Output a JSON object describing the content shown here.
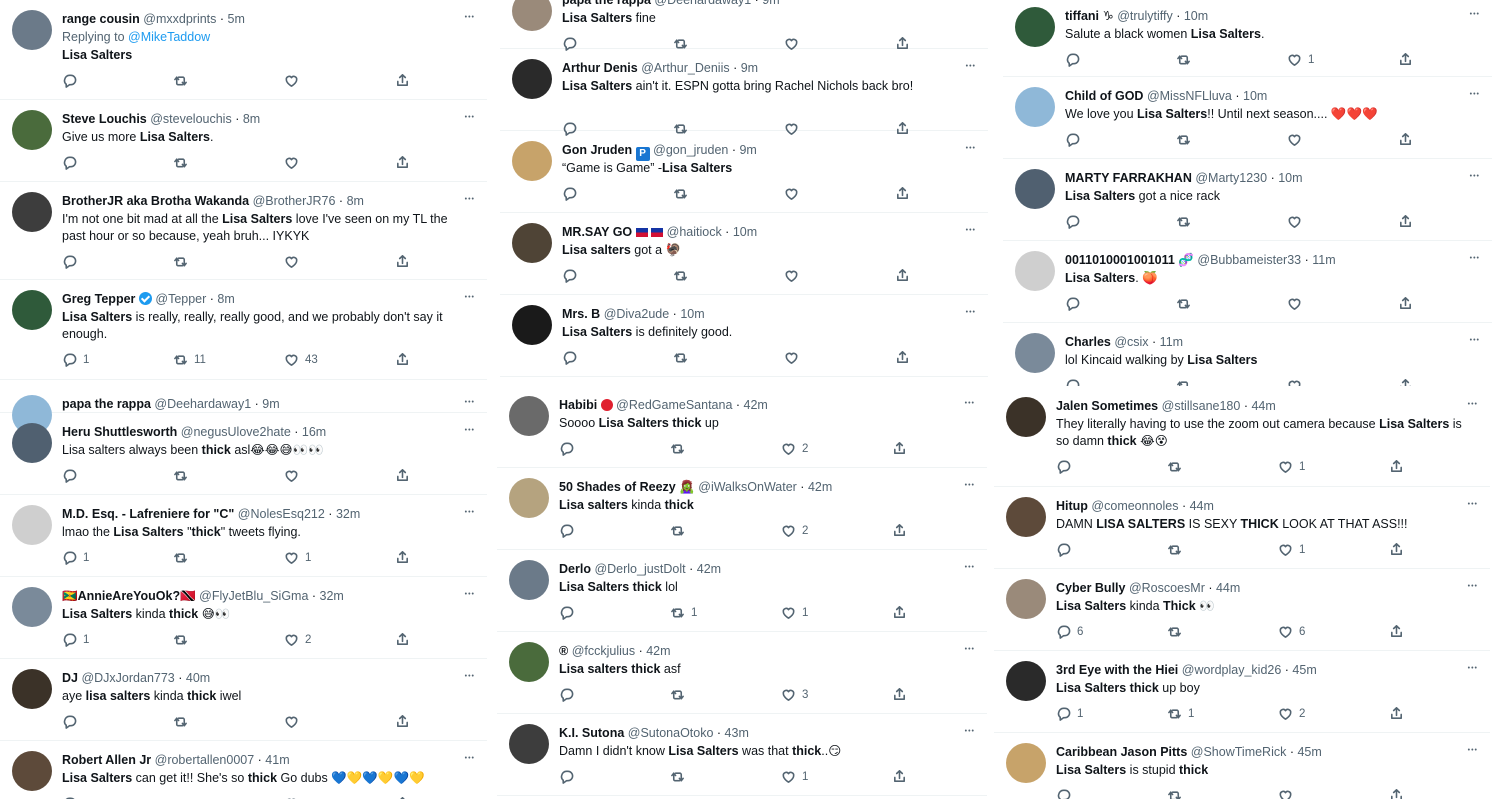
{
  "columns": [
    {
      "id": "col1",
      "tweets": [
        {
          "name": "range cousin",
          "handle": "@mxxdprints",
          "time": "5m",
          "reply_prefix": "Replying to ",
          "reply_to": "@MikeTaddow",
          "body": [
            {
              "b": "Lisa Salters"
            }
          ],
          "counts": [
            "",
            "",
            ""
          ]
        },
        {
          "name": "Steve Louchis",
          "handle": "@stevelouchis",
          "time": "8m",
          "body": [
            {
              "t": "Give us more "
            },
            {
              "b": "Lisa Salters"
            },
            {
              "t": "."
            }
          ],
          "counts": [
            "",
            "",
            ""
          ]
        },
        {
          "name": "BrotherJR aka Brotha Wakanda",
          "handle": "@BrotherJR76",
          "time": "8m",
          "body": [
            {
              "t": "I'm not one bit mad at all the "
            },
            {
              "b": "Lisa Salters"
            },
            {
              "t": " love I've seen on my TL the past hour or so because, yeah bruh... IYKYK"
            }
          ],
          "counts": [
            "",
            "",
            ""
          ]
        },
        {
          "name": "Greg Tepper",
          "verified": true,
          "handle": "@Tepper",
          "time": "8m",
          "body": [
            {
              "b": "Lisa Salters"
            },
            {
              "t": " is really, really, really good, and we probably don't say it enough."
            }
          ],
          "counts": [
            "1",
            "11",
            "43"
          ]
        },
        {
          "name": "papa the rappa",
          "handle": "@Deehardaway1",
          "time": "9m",
          "body": [],
          "counts": [
            "",
            "",
            ""
          ]
        },
        {
          "name": "Heru Shuttlesworth",
          "handle": "@negusUlove2hate",
          "time": "16m",
          "body": [
            {
              "t": "Lisa salters always been "
            },
            {
              "b": "thick"
            },
            {
              "t": " asl😂😂😅👀👀"
            }
          ],
          "counts": [
            "",
            "",
            ""
          ]
        },
        {
          "name": "M.D. Esq. - Lafreniere for \"C\"",
          "handle": "@NolesEsq212",
          "time": "32m",
          "body": [
            {
              "t": "lmao the "
            },
            {
              "b": "Lisa Salters"
            },
            {
              "t": " \""
            },
            {
              "b": "thick"
            },
            {
              "t": "\" tweets flying."
            }
          ],
          "counts": [
            "1",
            "",
            "1"
          ]
        },
        {
          "name": "🇬🇩AnnieAreYouOk?🇹🇹",
          "handle": "@FlyJetBlu_SiGma",
          "time": "32m",
          "body": [
            {
              "b": "Lisa  Salters"
            },
            {
              "t": " kinda "
            },
            {
              "b": "thick"
            },
            {
              "t": " 😅👀"
            }
          ],
          "counts": [
            "1",
            "",
            "2"
          ]
        },
        {
          "name": "DJ",
          "handle": "@DJxJordan773",
          "time": "40m",
          "body": [
            {
              "t": "aye "
            },
            {
              "b": "lisa salters"
            },
            {
              "t": " kinda "
            },
            {
              "b": "thick"
            },
            {
              "t": " iwel"
            }
          ],
          "counts": [
            "",
            "",
            ""
          ]
        },
        {
          "name": "Robert Allen Jr",
          "handle": "@robertallen0007",
          "time": "41m",
          "body": [
            {
              "b": "Lisa Salters"
            },
            {
              "t": " can get it!! She's so "
            },
            {
              "b": "thick"
            },
            {
              "t": " Go dubs 💙💛💙💛💙💛"
            }
          ],
          "counts": [
            "",
            "",
            ""
          ]
        }
      ]
    },
    {
      "id": "col2",
      "tweets": [
        {
          "name": "papa the rappa",
          "handle": "@Deehardaway1",
          "time": "9m",
          "body": [
            {
              "b": "Lisa Salters"
            },
            {
              "t": " fine"
            }
          ],
          "counts": [
            "",
            "",
            ""
          ]
        },
        {
          "name": "Arthur Denis",
          "handle": "@Arthur_Deniis",
          "time": "9m",
          "body": [
            {
              "b": "Lisa Salters"
            },
            {
              "t": " ain't it. ESPN gotta bring Rachel Nichols back bro!"
            }
          ],
          "counts": [
            "",
            "",
            ""
          ]
        },
        {
          "name": "Gon Jruden",
          "badge": "P",
          "handle": "@gon_jruden",
          "time": "9m",
          "body": [
            {
              "t": "“Game is Game” -"
            },
            {
              "b": "Lisa Salters"
            }
          ],
          "counts": [
            "",
            "",
            ""
          ]
        },
        {
          "name": "MR.SAY GO",
          "flags": 2,
          "handle": "@haitiock",
          "time": "10m",
          "body": [
            {
              "b": "Lisa salters"
            },
            {
              "t": " got a 🦃"
            }
          ],
          "counts": [
            "",
            "",
            ""
          ]
        },
        {
          "name": "Mrs. B",
          "handle": "@Diva2ude",
          "time": "10m",
          "body": [
            {
              "b": "Lisa Salters"
            },
            {
              "t": " is definitely good."
            }
          ],
          "counts": [
            "",
            "",
            ""
          ]
        },
        {
          "name": "Habibi",
          "redcircle": true,
          "handle": "@RedGameSantana",
          "time": "42m",
          "body": [
            {
              "t": "Soooo "
            },
            {
              "b": "Lisa Salters thick"
            },
            {
              "t": " up"
            }
          ],
          "counts": [
            "",
            "",
            "2"
          ]
        },
        {
          "name": "50 Shades of Reezy 🧟‍♀️",
          "handle": "@iWalksOnWater",
          "time": "42m",
          "body": [
            {
              "b": "Lisa salters"
            },
            {
              "t": " kinda "
            },
            {
              "b": "thick"
            }
          ],
          "counts": [
            "",
            "",
            "2"
          ]
        },
        {
          "name": "Derlo",
          "handle": "@Derlo_justDolt",
          "time": "42m",
          "body": [
            {
              "b": "Lisa Salters thick"
            },
            {
              "t": " lol"
            }
          ],
          "counts": [
            "",
            "1",
            "1"
          ]
        },
        {
          "name": "®",
          "handle": "@fcckjulius",
          "time": "42m",
          "body": [
            {
              "b": "Lisa salters thick"
            },
            {
              "t": " asf"
            }
          ],
          "counts": [
            "",
            "",
            "3"
          ]
        },
        {
          "name": "K.I. Sutona",
          "handle": "@SutonaOtoko",
          "time": "43m",
          "body": [
            {
              "t": "Damn I didn't know "
            },
            {
              "b": "Lisa Salters"
            },
            {
              "t": " was that "
            },
            {
              "b": "thick"
            },
            {
              "t": "..😏"
            }
          ],
          "counts": [
            "",
            "",
            "1"
          ]
        }
      ]
    },
    {
      "id": "col3",
      "tweets": [
        {
          "name": "tiffani ♑",
          "handle": "@trulytiffy",
          "time": "10m",
          "body": [
            {
              "t": "Salute a black women "
            },
            {
              "b": "Lisa Salters"
            },
            {
              "t": "."
            }
          ],
          "counts": [
            "",
            "",
            "1"
          ]
        },
        {
          "name": "Child of GOD",
          "handle": "@MissNFLluva",
          "time": "10m",
          "body": [
            {
              "t": "We love you "
            },
            {
              "b": "Lisa Salters"
            },
            {
              "t": "!!  Until next season.... ❤️❤️❤️"
            }
          ],
          "counts": [
            "",
            "",
            ""
          ]
        },
        {
          "name": "MARTY FARRAKHAN",
          "handle": "@Marty1230",
          "time": "10m",
          "body": [
            {
              "b": "Lisa Salters"
            },
            {
              "t": " got a nice rack"
            }
          ],
          "counts": [
            "",
            "",
            ""
          ]
        },
        {
          "name": "0011010001001011",
          "handle": "🧬 @Bubbameister33",
          "time": "11m",
          "body": [
            {
              "b": "Lisa Salters"
            },
            {
              "t": ". 🍑"
            }
          ],
          "counts": [
            "",
            "",
            ""
          ]
        },
        {
          "name": "Charles",
          "handle": "@csix",
          "time": "11m",
          "body": [
            {
              "t": "lol Kincaid walking by "
            },
            {
              "b": "Lisa Salters"
            }
          ],
          "counts": [
            "",
            "",
            ""
          ]
        },
        {
          "name": "Jalen Sometimes",
          "handle": "@stillsane180",
          "time": "44m",
          "body": [
            {
              "t": "They literally having to use the zoom out camera because "
            },
            {
              "b": "Lisa Salters"
            },
            {
              "t": " is so damn "
            },
            {
              "b": "thick"
            },
            {
              "t": " 😂😵"
            }
          ],
          "counts": [
            "",
            "",
            "1"
          ]
        },
        {
          "name": "Hitup",
          "handle": "@comeonnoles",
          "time": "44m",
          "body": [
            {
              "t": "DAMN "
            },
            {
              "b": "LISA SALTERS"
            },
            {
              "t": " IS SEXY "
            },
            {
              "b": "THICK"
            },
            {
              "t": " LOOK AT THAT ASS!!!"
            }
          ],
          "counts": [
            "",
            "",
            "1"
          ]
        },
        {
          "name": "Cyber Bully",
          "handle": "@RoscoesMr",
          "time": "44m",
          "body": [
            {
              "b": "Lisa Salters"
            },
            {
              "t": " kinda "
            },
            {
              "b": "Thick"
            },
            {
              "t": " 👀"
            }
          ],
          "counts": [
            "6",
            "",
            "6"
          ]
        },
        {
          "name": "3rd Eye with the Hiei",
          "handle": "@wordplay_kid26",
          "time": "45m",
          "body": [
            {
              "b": "Lisa Salters thick"
            },
            {
              "t": " up boy"
            }
          ],
          "counts": [
            "1",
            "1",
            "2"
          ]
        },
        {
          "name": "Caribbean Jason Pitts",
          "handle": "@ShowTimeRick",
          "time": "45m",
          "body": [
            {
              "b": "Lisa Salters"
            },
            {
              "t": " is stupid "
            },
            {
              "b": "thick"
            }
          ],
          "counts": [
            "",
            "",
            ""
          ]
        }
      ]
    }
  ],
  "icons": {
    "more": "more-horizontal-icon",
    "reply": "reply-icon",
    "retweet": "retweet-icon",
    "like": "like-icon",
    "share": "share-icon"
  },
  "colors": {
    "link": "#1d9bf0",
    "muted": "#536471",
    "text": "#0f1419",
    "verified": "#1d9bf0"
  }
}
